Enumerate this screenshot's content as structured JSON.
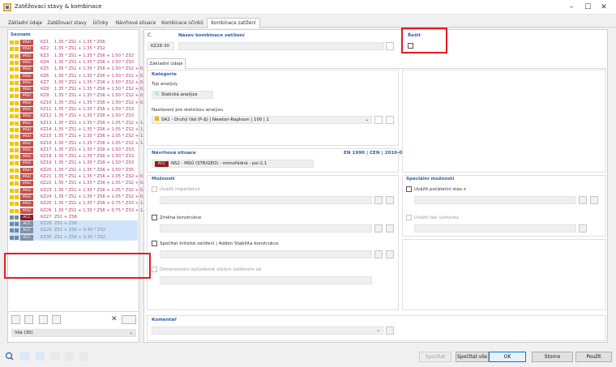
{
  "window": {
    "title": "Zatěžovací stavy & kombinace"
  },
  "tabs": [
    "Základní údaje",
    "Zatěžovací stavy",
    "Účinky",
    "Návrhové situace",
    "Kombinace účinků",
    "Kombinace zatížení"
  ],
  "list": {
    "header": "Seznam",
    "rows": [
      {
        "tag": "MSÚ",
        "id": "KZ1",
        "expr": "1.35 * ZS1 + 1.35 * ZS6"
      },
      {
        "tag": "MSÚ",
        "id": "KZ2",
        "expr": "1.35 * ZS1 + 1.35 * ZS2"
      },
      {
        "tag": "MSÚ",
        "id": "KZ3",
        "expr": "1.35 * ZS1 + 1.35 * ZS6 + 1.50 * ZS2"
      },
      {
        "tag": "MSÚ",
        "id": "KZ4",
        "expr": "1.35 * ZS1 + 1.35 * ZS6 + 1.50 * ZS3"
      },
      {
        "tag": "MSÚ",
        "id": "KZ5",
        "expr": "1.35 * ZS1 + 1.35 * ZS6 + 1.50 * ZS2 + 0."
      },
      {
        "tag": "MSÚ",
        "id": "KZ6",
        "expr": "1.35 * ZS1 + 1.35 * ZS6 + 1.50 * ZS2 + 0."
      },
      {
        "tag": "MSÚ",
        "id": "KZ7",
        "expr": "1.35 * ZS1 + 1.35 * ZS6 + 1.50 * ZS2 + 0."
      },
      {
        "tag": "MSÚ",
        "id": "KZ8",
        "expr": "1.35 * ZS1 + 1.35 * ZS6 + 1.50 * ZS2 + 0."
      },
      {
        "tag": "MSÚ",
        "id": "KZ9",
        "expr": "1.35 * ZS1 + 1.35 * ZS6 + 1.50 * ZS2 + 0."
      },
      {
        "tag": "MSÚ",
        "id": "KZ10",
        "expr": "1.35 * ZS1 + 1.35 * ZS6 + 1.50 * ZS2 + 0."
      },
      {
        "tag": "MSÚ",
        "id": "KZ11",
        "expr": "1.35 * ZS1 + 1.35 * ZS6 + 1.50 * ZS3"
      },
      {
        "tag": "MSÚ",
        "id": "KZ12",
        "expr": "1.35 * ZS1 + 1.35 * ZS6 + 1.50 * ZS3"
      },
      {
        "tag": "MSÚ",
        "id": "KZ13",
        "expr": "1.35 * ZS1 + 1.35 * ZS6 + 1.05 * ZS2 + 1."
      },
      {
        "tag": "MSÚ",
        "id": "KZ14",
        "expr": "1.35 * ZS1 + 1.35 * ZS6 + 1.05 * ZS2 + 1."
      },
      {
        "tag": "MSÚ",
        "id": "KZ15",
        "expr": "1.35 * ZS1 + 1.35 * ZS6 + 1.05 * ZS2 + 1."
      },
      {
        "tag": "MSÚ",
        "id": "KZ16",
        "expr": "1.35 * ZS1 + 1.35 * ZS6 + 1.05 * ZS2 + 1."
      },
      {
        "tag": "MSÚ",
        "id": "KZ17",
        "expr": "1.35 * ZS1 + 1.35 * ZS6 + 1.50 * ZS3"
      },
      {
        "tag": "MSÚ",
        "id": "KZ18",
        "expr": "1.35 * ZS1 + 1.35 * ZS6 + 1.50 * ZS3"
      },
      {
        "tag": "MSÚ",
        "id": "KZ19",
        "expr": "1.35 * ZS1 + 1.35 * ZS6 + 1.50 * ZS3"
      },
      {
        "tag": "MSÚ",
        "id": "KZ20",
        "expr": "1.35 * ZS1 + 1.35 * ZS6 + 1.50 * ZS5"
      },
      {
        "tag": "MSÚ",
        "id": "KZ21",
        "expr": "1.35 * ZS1 + 1.35 * ZS6 + 1.05 * ZS2 + 0."
      },
      {
        "tag": "MSÚ",
        "id": "KZ22",
        "expr": "1.35 * ZS1 + 1.35 * ZS6 + 1.05 * ZS2 + 0."
      },
      {
        "tag": "MSÚ",
        "id": "KZ23",
        "expr": "1.35 * ZS1 + 1.35 * ZS6 + 1.05 * ZS2 + 0."
      },
      {
        "tag": "MSÚ",
        "id": "KZ24",
        "expr": "1.35 * ZS1 + 1.35 * ZS6 + 1.05 * ZS2 + 0."
      },
      {
        "tag": "MSÚ",
        "id": "KZ25",
        "expr": "1.35 * ZS1 + 1.35 * ZS6 + 0.75 * ZS3 + 1."
      },
      {
        "tag": "MSÚ",
        "id": "KZ26",
        "expr": "1.35 * ZS1 + 1.35 * ZS6 + 0.75 * ZS3 + 1."
      },
      {
        "tag": "ACC",
        "id": "KZ27",
        "expr": "ZS1 + ZS6"
      },
      {
        "tag": "ACC",
        "id": "KZ28",
        "expr": "ZS1 + ZS6"
      },
      {
        "tag": "ACC",
        "id": "KZ29",
        "expr": "ZS1 + ZS6 + 0.30 * ZS2"
      },
      {
        "tag": "ACC",
        "id": "KZ30",
        "expr": "ZS1 + ZS6 + 0.30 * ZS2"
      }
    ],
    "filter": "Vše (30)"
  },
  "form": {
    "no_label": "Č.",
    "no_value": "KZ28-30",
    "name_label": "Název kombinace zatížení",
    "solve_label": "Řešit",
    "subtab": "Základní údaje",
    "category": "Kategorie",
    "analysis_type_label": "Typ analýzy",
    "analysis_type_value": "Statická analýza",
    "static_settings_label": "Nastavení pro statickou analýzu",
    "static_settings_value": "SA2 - Druhý řád (P-Δ) | Newton-Raphson | 100 | 1",
    "design_situation_label": "Návrhová situace",
    "design_situation_norm": "EN 1990 | CEN | 2010-04",
    "design_situation_tag": "ACC",
    "design_situation_value": "NS2 - MSÚ (STR/GEO) - mimořádná - psi-2,1",
    "options_header": "Možnosti",
    "opt_imperfection": "Uvážit imperfekce",
    "opt_structure_change": "Změna konstrukce",
    "opt_critical_load": "Spočítat kritické zatížení | Addon Stabilita konstrukce",
    "opt_consider_from": "Dotransování způsobené stálým zatížením od",
    "special_header": "Speciální možnosti",
    "special_initial_state": "Uvážit počáteční stav z",
    "special_construction_stage": "Uvážit fázi výstavby",
    "comment_label": "Komentář"
  },
  "buttons": {
    "calculate": "Spočítat",
    "calculate_all": "Spočítat vše",
    "ok": "OK",
    "cancel": "Storno",
    "apply": "Použít"
  },
  "colors": {
    "msu_tag": "#c0504d",
    "acc_tag": "#8b1e1e",
    "accent": "#2d5ea8",
    "highlight": "#e31b23"
  }
}
